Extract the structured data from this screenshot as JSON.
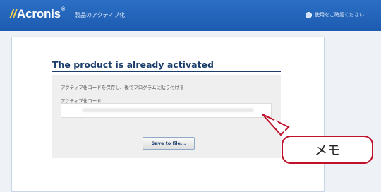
{
  "header": {
    "logo_text": "Acronis",
    "logo_tm": "®",
    "section_title": "製品のアクティブ化",
    "help_link": "使用をご確認ください"
  },
  "main": {
    "heading": "The product is already activated",
    "instructions": "アクティブ化コードを保存し、後でプログラムに貼り付ける",
    "code_label": "アクティブ化コード",
    "code_value": "xxxxxxxxxxxxxxxxxxxxxxxxxxxxxxxxxxxxxxxxxxxxxxxxxxxxxxx",
    "save_button": "Save to file..."
  },
  "annotation": {
    "label": "メモ"
  },
  "colors": {
    "topbar": "#1d5bb0",
    "heading": "#1b3d6b",
    "callout_stroke": "#c0102a"
  }
}
